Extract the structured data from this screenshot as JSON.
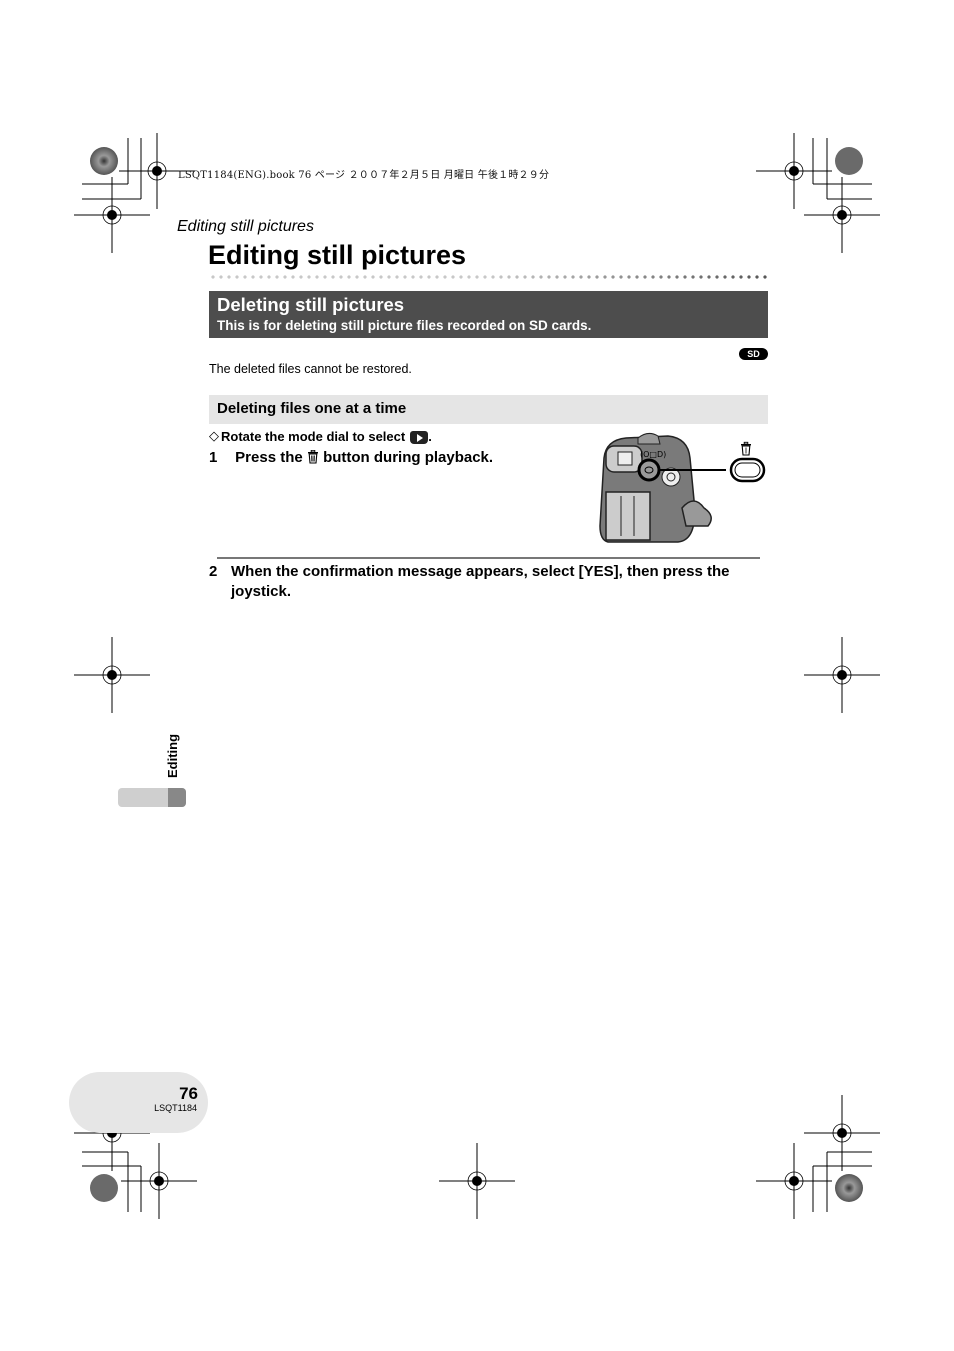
{
  "print_header": "LSQT1184(ENG).book  76 ページ  ２００７年２月５日  月曜日  午後１時２９分",
  "running_head": "Editing still pictures",
  "page_title": "Editing still pictures",
  "section": {
    "title": "Deleting still pictures",
    "subtitle": "This is for deleting still picture files recorded on SD cards."
  },
  "media_badge": "SD",
  "note": "The deleted files cannot be restored.",
  "subsection": {
    "title": "Deleting files one at a time"
  },
  "pre_step": {
    "symbol": "◇",
    "text": "Rotate the mode dial to select",
    "icon": "playback-mode-icon",
    "suffix": "."
  },
  "steps": [
    {
      "number": "1",
      "text_before": "Press the",
      "icon": "trash-icon",
      "text_after": "button during playback."
    },
    {
      "number": "2",
      "text": "When the confirmation message appears, select [YES], then press the joystick."
    }
  ],
  "figure": {
    "description": "camcorder-rear-view",
    "callout_icon": "trash-icon"
  },
  "side_tab": {
    "label": "Editing"
  },
  "footer": {
    "page_number": "76",
    "doc_code": "LSQT1184"
  }
}
